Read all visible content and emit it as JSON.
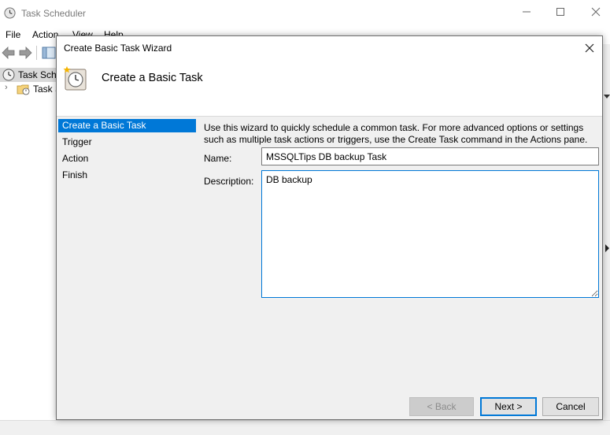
{
  "background_window": {
    "title": "Task Scheduler",
    "menu": [
      "File",
      "Action",
      "View",
      "Help"
    ],
    "tree": [
      {
        "label": "Task Scheduler (Local)",
        "icon": "clock-icon",
        "selected": true
      },
      {
        "label": "Task Scheduler Library",
        "icon": "folder-clock-icon",
        "selected": false
      }
    ]
  },
  "dialog": {
    "title": "Create Basic Task Wizard",
    "header_title": "Create a Basic Task",
    "nav_items": [
      {
        "label": "Create a Basic Task",
        "selected": true
      },
      {
        "label": "Trigger",
        "selected": false
      },
      {
        "label": "Action",
        "selected": false
      },
      {
        "label": "Finish",
        "selected": false
      }
    ],
    "description_text": "Use this wizard to quickly schedule a common task.  For more advanced options or settings such as multiple task actions or triggers, use the Create Task command in the Actions pane.",
    "name_label": "Name:",
    "name_value": "MSSQLTips DB backup Task",
    "description_label": "Description:",
    "description_value": "DB backup",
    "buttons": {
      "back": "< Back",
      "next": "Next >",
      "cancel": "Cancel"
    }
  },
  "colors": {
    "accent": "#0078d7",
    "dialog_bg": "#f0f0f0",
    "disabled_btn": "#cccccc"
  }
}
